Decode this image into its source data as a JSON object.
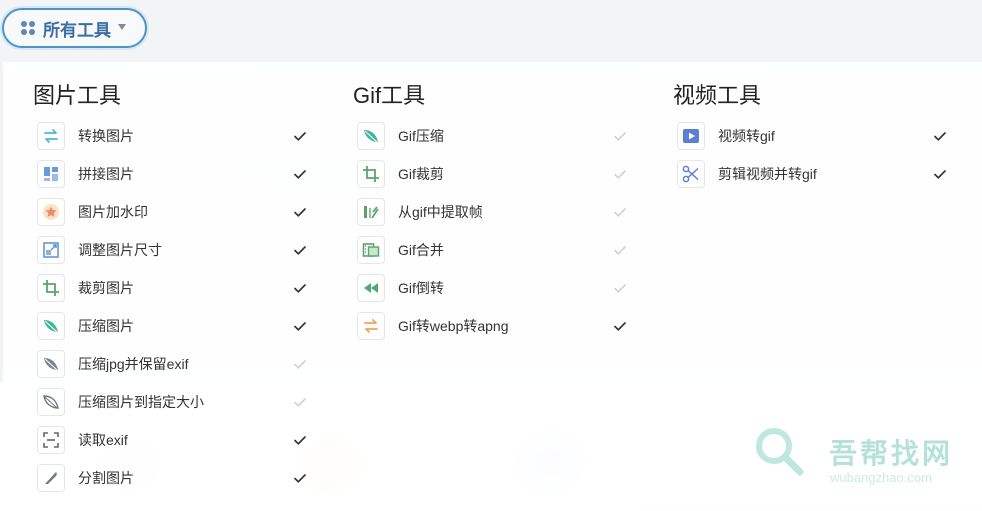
{
  "top_button": {
    "label": "所有工具",
    "icon": "apps-grid-icon"
  },
  "columns": [
    {
      "title": "图片工具",
      "items": [
        {
          "label": "转换图片",
          "icon": "convert-arrows-icon",
          "checked": true
        },
        {
          "label": "拼接图片",
          "icon": "collage-icon",
          "checked": true
        },
        {
          "label": "图片加水印",
          "icon": "star-watermark-icon",
          "checked": true
        },
        {
          "label": "调整图片尺寸",
          "icon": "resize-icon",
          "checked": true
        },
        {
          "label": "裁剪图片",
          "icon": "crop-icon",
          "checked": true
        },
        {
          "label": "压缩图片",
          "icon": "leaf-compress-icon",
          "checked": true
        },
        {
          "label": "压缩jpg并保留exif",
          "icon": "leaf-compress-gray-icon",
          "checked": false
        },
        {
          "label": "压缩图片到指定大小",
          "icon": "leaf-outline-icon",
          "checked": false
        },
        {
          "label": "读取exif",
          "icon": "scan-frame-icon",
          "checked": true
        },
        {
          "label": "分割图片",
          "icon": "knife-icon",
          "checked": true
        }
      ]
    },
    {
      "title": "Gif工具",
      "items": [
        {
          "label": "Gif压缩",
          "icon": "leaf-compress-icon",
          "checked": false
        },
        {
          "label": "Gif裁剪",
          "icon": "crop-icon",
          "checked": false
        },
        {
          "label": "从gif中提取帧",
          "icon": "extract-frames-icon",
          "checked": false
        },
        {
          "label": "Gif合并",
          "icon": "film-merge-icon",
          "checked": false
        },
        {
          "label": "Gif倒转",
          "icon": "rewind-icon",
          "checked": false
        },
        {
          "label": "Gif转webp转apng",
          "icon": "convert-arrows-orange-icon",
          "checked": true
        }
      ]
    },
    {
      "title": "视频工具",
      "items": [
        {
          "label": "视频转gif",
          "icon": "video-play-icon",
          "checked": true
        },
        {
          "label": "剪辑视频并转gif",
          "icon": "scissors-icon",
          "checked": true
        }
      ]
    }
  ],
  "watermark": {
    "title": "吾帮找网",
    "subtitle": "wubangzhao.com"
  },
  "colors": {
    "accent": "#4d95c8",
    "check_on": "#333333",
    "check_off": "#cfd3d8"
  }
}
